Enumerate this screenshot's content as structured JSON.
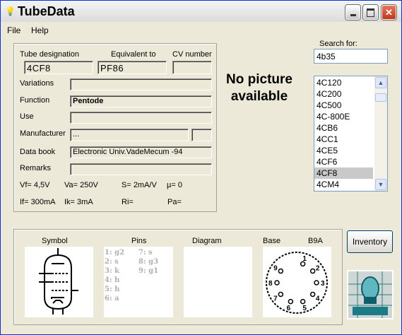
{
  "window": {
    "title": "TubeData"
  },
  "menu": {
    "file": "File",
    "help": "Help"
  },
  "info": {
    "tube_designation_label": "Tube designation",
    "equivalent_label": "Equivalent to",
    "cv_label": "CV number",
    "tube_designation": "4CF8",
    "equivalent": "PF86",
    "cv_number": "",
    "variations_label": "Variations",
    "variations": "",
    "function_label": "Function",
    "function": "Pentode",
    "use_label": "Use",
    "use": "",
    "manufacturer_label": "Manufacturer",
    "manufacturer": "...",
    "manufacturer_extra": "",
    "databook_label": "Data book",
    "databook": "Electronic Univ.VadeMecum -94",
    "remarks_label": "Remarks",
    "remarks": ""
  },
  "params": {
    "vf": "Vf= 4,5V",
    "va": "Va= 250V",
    "s": "S= 2mA/V",
    "mu": "µ=    0",
    "if": "If= 300mA",
    "ik": "Ik=   3mA",
    "ri": "Ri=",
    "pa": "Pa="
  },
  "picture": {
    "no_picture": "No picture available"
  },
  "search": {
    "label": "Search for:",
    "value": "4b35",
    "items": [
      "4C120",
      "4C200",
      "4C500",
      "4C-800E",
      "4CB6",
      "4CC1",
      "4CE5",
      "4CF6",
      "4CF8",
      "4CM4"
    ],
    "selected": "4CF8"
  },
  "bottom": {
    "symbol_label": "Symbol",
    "pins_label": "Pins",
    "diagram_label": "Diagram",
    "base_label": "Base",
    "base_type": "B9A",
    "pins_col1": "1: g2\n2: s\n3: k\n4: h\n5: h\n6: a",
    "pins_col2": "7: s\n8: g3\n9: g1",
    "base_numbers": [
      "1",
      "2",
      "3",
      "4",
      "5",
      "6",
      "7",
      "8",
      "9"
    ],
    "inventory": "Inventory"
  },
  "colors": {
    "window_bg": "#ece9d8",
    "title_border": "#0831d9",
    "close": "#c0371a",
    "selection": "#c9c9c9"
  }
}
